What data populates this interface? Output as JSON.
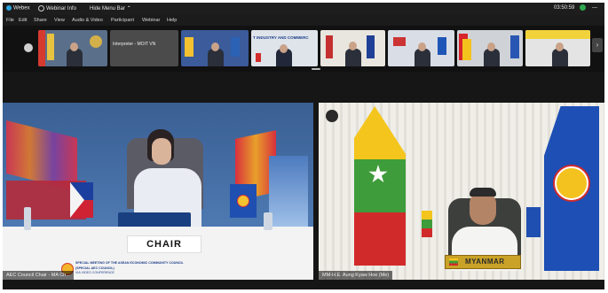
{
  "app": {
    "name": "Webex",
    "webinar_info": "Webinar Info",
    "hide_menu": "Hide Menu Bar",
    "timer": "03:50:59"
  },
  "menu": [
    "File",
    "Edit",
    "Share",
    "View",
    "Audio & Video",
    "Participant",
    "Webinar",
    "Help"
  ],
  "thumbnails": [
    {
      "label": ""
    },
    {
      "label": "Interpreter - MOIT VN"
    },
    {
      "label": ""
    },
    {
      "label": "T INDUSTRY AND COMMERC"
    },
    {
      "label": ""
    },
    {
      "label": ""
    },
    {
      "label": ""
    },
    {
      "label": ""
    }
  ],
  "left_video": {
    "label": "AEC Council Chair - MA Ch...",
    "nameplate": "CHAIR",
    "banner_line1": "SPECIAL MEETING OF THE ASEAN ECONOMIC COMMUNITY COUNCIL",
    "banner_line2": "(SPECIAL AEC COUNCIL)",
    "banner_line3": "VIA VIDEO CONFERENCE"
  },
  "right_video": {
    "label": "MM-H.E. Aung Kyaw Hoe (Me)",
    "nameplate": "MYANMAR"
  },
  "colors": {
    "accent": "#2aa3e0",
    "chair_bg": "#f2f2f2",
    "myanmar_plate": "#c9a227"
  }
}
